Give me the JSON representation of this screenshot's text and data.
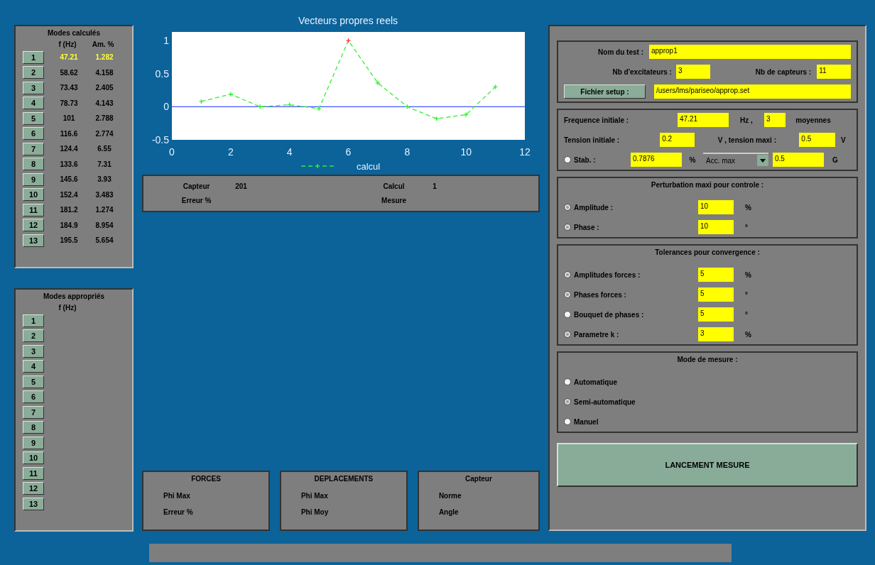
{
  "modes_calcules": {
    "title": "Modes calculés",
    "columns": [
      "f (Hz)",
      "Am. %"
    ],
    "rows": [
      {
        "button": "1",
        "freq": "47.21",
        "am": "1.282",
        "selected": true
      },
      {
        "button": "2",
        "freq": "58.62",
        "am": "4.158",
        "selected": false
      },
      {
        "button": "3",
        "freq": "73.43",
        "am": "2.405",
        "selected": false
      },
      {
        "button": "4",
        "freq": "78.73",
        "am": "4.143",
        "selected": false
      },
      {
        "button": "5",
        "freq": "101",
        "am": "2.788",
        "selected": false
      },
      {
        "button": "6",
        "freq": "116.6",
        "am": "2.774",
        "selected": false
      },
      {
        "button": "7",
        "freq": "124.4",
        "am": "6.55",
        "selected": false
      },
      {
        "button": "8",
        "freq": "133.6",
        "am": "7.31",
        "selected": false
      },
      {
        "button": "9",
        "freq": "145.6",
        "am": "3.93",
        "selected": false
      },
      {
        "button": "10",
        "freq": "152.4",
        "am": "3.483",
        "selected": false
      },
      {
        "button": "11",
        "freq": "181.2",
        "am": "1.274",
        "selected": false
      },
      {
        "button": "12",
        "freq": "184.9",
        "am": "8.954",
        "selected": false
      },
      {
        "button": "13",
        "freq": "195.5",
        "am": "5.654",
        "selected": false
      }
    ]
  },
  "modes_appropries": {
    "title": "Modes appropriés",
    "columns": [
      "f (Hz)"
    ],
    "buttons": [
      "1",
      "2",
      "3",
      "4",
      "5",
      "6",
      "7",
      "8",
      "9",
      "10",
      "11",
      "12",
      "13"
    ]
  },
  "chart": {
    "chart_data": {
      "type": "line",
      "title": "Vecteurs propres reels",
      "x": [
        1,
        2,
        3,
        4,
        5,
        6,
        7,
        8,
        9,
        10,
        11
      ],
      "series": [
        {
          "name": "calcul",
          "color": "#33ee33",
          "line_style": "dashed",
          "marker": "+",
          "values": [
            0.08,
            0.19,
            0,
            0.03,
            -0.03,
            1,
            0.36,
            0,
            -0.18,
            -0.12,
            0.3
          ]
        },
        {
          "color": "#ff3333",
          "line_style": "none",
          "marker": "+",
          "values": [
            null,
            null,
            null,
            null,
            null,
            1,
            null,
            null,
            null,
            null,
            null
          ]
        }
      ],
      "ref_lines": [
        {
          "axis": "y",
          "value": 0,
          "color": "#4455ff"
        }
      ],
      "xlim": [
        0,
        12
      ],
      "ylim": [
        -0.5,
        1.13
      ],
      "xticks": [
        0,
        2,
        4,
        6,
        8,
        10,
        12
      ],
      "yticks": [
        -0.5,
        0,
        0.5,
        1
      ]
    }
  },
  "info": {
    "row_1": [
      {
        "label": "Capteur",
        "value": "201"
      },
      {
        "label": "Calcul",
        "value": "1"
      }
    ],
    "row_2": [
      {
        "label": "Erreur %"
      },
      {
        "label": "Mesure"
      }
    ]
  },
  "bottom_boxes": [
    {
      "title": "FORCES",
      "lines": [
        "Phi Max",
        "Erreur %"
      ]
    },
    {
      "title": "DEPLACEMENTS",
      "lines": [
        "Phi Max",
        "Phi Moy"
      ]
    },
    {
      "title": "Capteur",
      "lines": [
        "Norme",
        "Angle"
      ]
    }
  ],
  "test": {
    "nom_label": "Nom du test :",
    "nom": "approp1",
    "exc_label": "Nb d'excitateurs :",
    "exc": "3",
    "capt_label": "Nb de capteurs :",
    "capt": "11",
    "setup_button": "Fichier setup :",
    "setup": "/users/lms/pariseo/approp.set"
  },
  "excitation": {
    "freq_label": "Frequence initiale :",
    "freq": "47.21",
    "hz": "Hz ,",
    "moy": "3",
    "moy_label": "moyennes",
    "tension_label": "Tension initiale :",
    "tension": "0.2",
    "tmax_label": "V , tension maxi :",
    "tmax": "0.5",
    "v": "V",
    "stab": {
      "label": "Stab. :",
      "selected": false
    },
    "stab_value": "0.7876",
    "pct": "%",
    "dropdown": "Acc. max",
    "acc": "0.5",
    "g": "G"
  },
  "perturbation": {
    "title": "Perturbation maxi pour controle :",
    "items": [
      {
        "label": "Amplitude :",
        "value": "10",
        "unit": "%",
        "selected": true
      },
      {
        "label": "Phase :",
        "value": "10",
        "unit": "°",
        "selected": true
      }
    ]
  },
  "tolerances": {
    "title": "Tolerances pour convergence :",
    "items": [
      {
        "label": "Amplitudes forces :",
        "value": "5",
        "unit": "%",
        "selected": true
      },
      {
        "label": "Phases forces :",
        "value": "5",
        "unit": "°",
        "selected": true
      },
      {
        "label": "Bouquet de phases :",
        "value": "5",
        "unit": "°",
        "selected": false
      },
      {
        "label": "Parametre k :",
        "value": "3",
        "unit": "%",
        "selected": true
      }
    ]
  },
  "mode_mesure": {
    "title": "Mode de mesure :",
    "items": [
      {
        "label": "Automatique",
        "selected": false
      },
      {
        "label": "Semi-automatique",
        "selected": true
      },
      {
        "label": "Manuel",
        "selected": false
      }
    ]
  },
  "launch_button": "LANCEMENT MESURE"
}
